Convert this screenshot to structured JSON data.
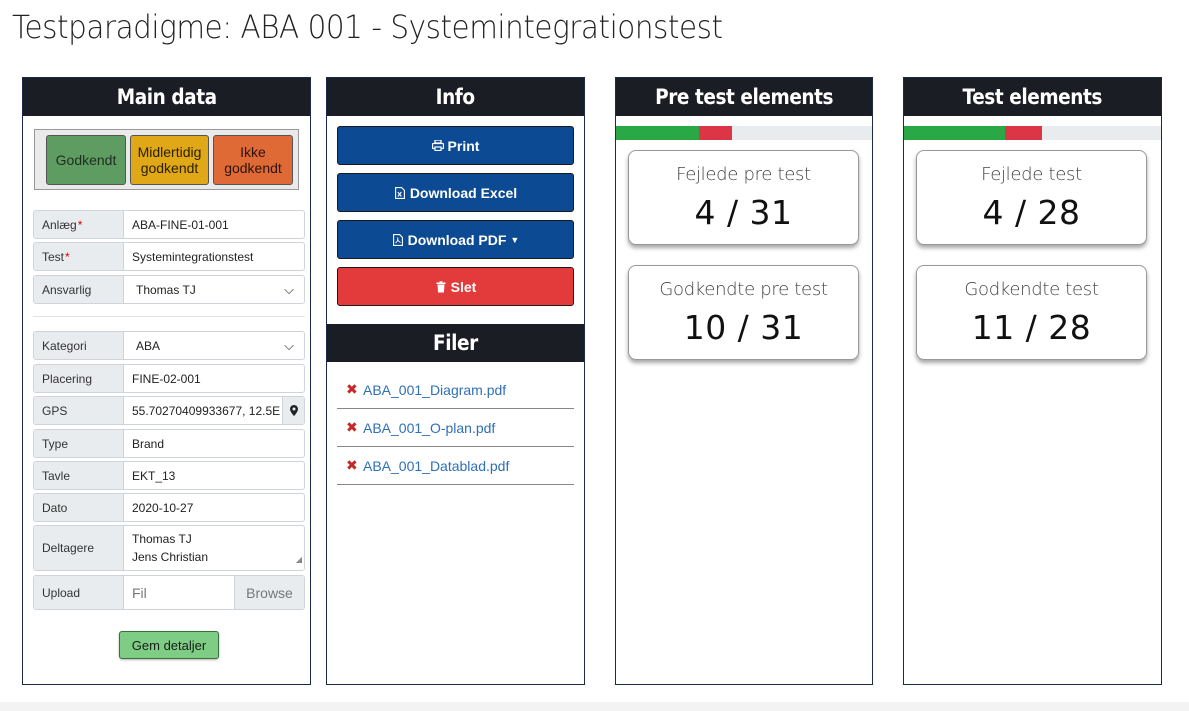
{
  "page": {
    "title": "Testparadigme: ABA 001 - Systemintegrationstest"
  },
  "main": {
    "heading": "Main data",
    "status": {
      "approved": "Godkendt",
      "temporary": "Midlertidig godkendt",
      "rejected": "Ikke godkendt"
    },
    "fields": {
      "anlaeg": {
        "label": "Anlæg",
        "required": "*",
        "value": "ABA-FINE-01-001"
      },
      "test": {
        "label": "Test",
        "required": "*",
        "value": "Systemintegrationstest"
      },
      "ansvarlig": {
        "label": "Ansvarlig",
        "value": "Thomas TJ"
      },
      "kategori": {
        "label": "Kategori",
        "value": "ABA"
      },
      "placering": {
        "label": "Placering",
        "value": "FINE-02-001"
      },
      "gps": {
        "label": "GPS",
        "value": "55.70270409933677, 12.5E"
      },
      "type": {
        "label": "Type",
        "value": "Brand"
      },
      "tavle": {
        "label": "Tavle",
        "value": "EKT_13"
      },
      "dato": {
        "label": "Dato",
        "value": "2020-10-27"
      },
      "deltagere": {
        "label": "Deltagere",
        "line1": "Thomas TJ",
        "line2": "Jens Christian"
      },
      "upload": {
        "label": "Upload",
        "placeholder": "Fil",
        "browse": "Browse"
      }
    },
    "save": "Gem detaljer"
  },
  "info": {
    "heading": "Info",
    "buttons": {
      "print": "Print",
      "excel": "Download Excel",
      "pdf": "Download PDF",
      "delete": "Slet"
    },
    "files_heading": "Filer",
    "files": [
      "ABA_001_Diagram.pdf",
      "ABA_001_O-plan.pdf",
      "ABA_001_Datablad.pdf"
    ]
  },
  "pre": {
    "heading": "Pre test elements",
    "progress": {
      "passed": 10,
      "failed": 4,
      "total": 31
    },
    "failed_label": "Fejlede pre test",
    "failed_value": "4 / 31",
    "passed_label": "Godkendte pre test",
    "passed_value": "10 / 31"
  },
  "test": {
    "heading": "Test elements",
    "progress": {
      "passed": 11,
      "failed": 4,
      "total": 28
    },
    "failed_label": "Fejlede test",
    "failed_value": "4 / 28",
    "passed_label": "Godkendte test",
    "passed_value": "11 / 28"
  },
  "colors": {
    "approved": "#5e9c62",
    "temporary": "#e0a716",
    "rejected": "#df6a36",
    "primary": "#0c4a93",
    "danger": "#e33b3b",
    "success_bar": "#2aa845",
    "fail_bar": "#dc3545"
  },
  "icons": {
    "print": "printer-icon",
    "excel": "file-excel-icon",
    "pdf": "file-pdf-icon",
    "delete": "trash-icon",
    "gps": "map-marker-icon",
    "file_remove": "close-icon"
  }
}
